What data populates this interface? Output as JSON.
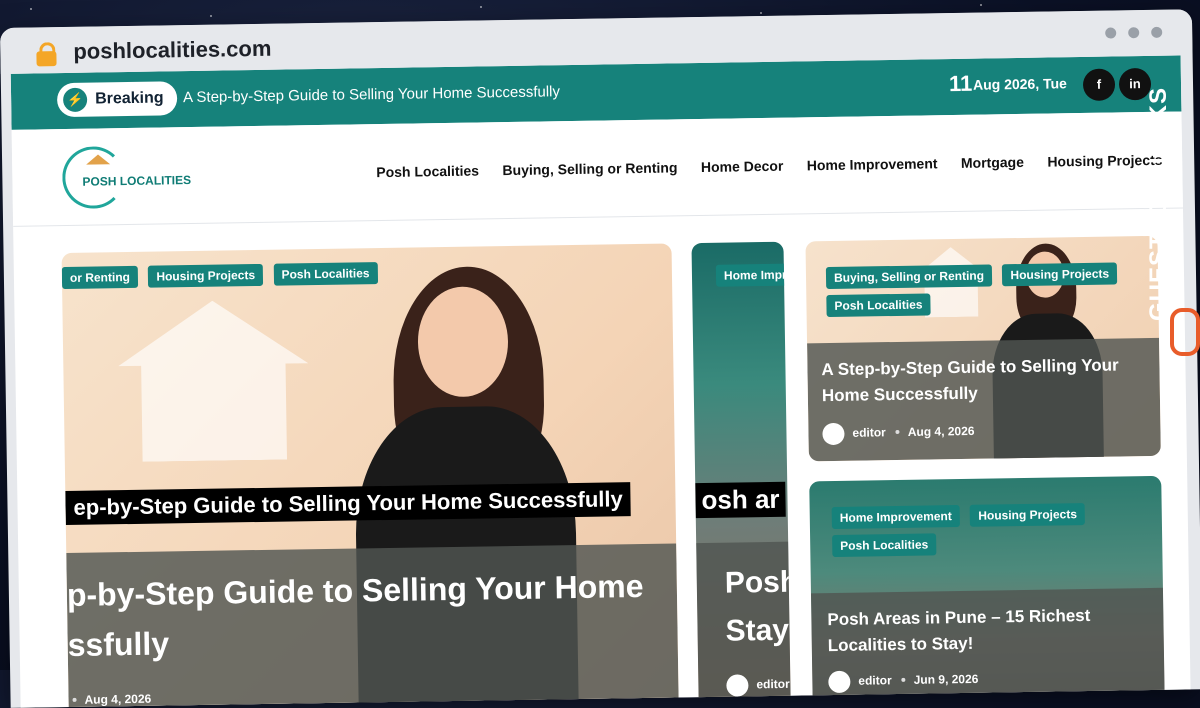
{
  "browser": {
    "url": "poshlocalities.com"
  },
  "topbar": {
    "breaking_label": "Breaking",
    "ticker_text": "A Step-by-Step Guide to Selling Your Home Successfully",
    "date_day": "11",
    "date_rest": "Aug 2026, Tue",
    "social": [
      {
        "icon": "facebook-icon",
        "label": "f"
      },
      {
        "icon": "linkedin-icon",
        "label": "in"
      }
    ]
  },
  "header": {
    "logo_text": "POSH LOCALITIES",
    "nav": [
      "Posh Localities",
      "Buying, Selling or Renting",
      "Home Decor",
      "Home Improvement",
      "Mortgage",
      "Housing Projects"
    ]
  },
  "main_card": {
    "tags": [
      "or Renting",
      "Housing Projects",
      "Posh Localities"
    ],
    "banner": "ep-by-Step Guide to Selling Your Home Successfully",
    "title_line1": "p-by-Step Guide to Selling Your Home",
    "title_line2": "ssfully",
    "date": "Aug 4, 2026"
  },
  "middle_card": {
    "tag": "Home Impr",
    "banner": "osh ar",
    "title_line1": "Posh",
    "title_line2": "Stay",
    "author": "editor"
  },
  "right_top": {
    "tags": [
      "Buying, Selling or Renting",
      "Housing Projects",
      "Posh Localities"
    ],
    "title": "A Step-by-Step Guide to Selling Your Home Successfully",
    "author": "editor",
    "date": "Aug 4, 2026"
  },
  "right_bottom": {
    "tags": [
      "Home Improvement",
      "Housing Projects",
      "Posh Localities"
    ],
    "title": "Posh Areas in Pune – 15 Richest Localities to Stay!",
    "author": "editor",
    "date": "Jun 9, 2026"
  },
  "brand": {
    "name": "GUESTPOSTLINKS"
  }
}
